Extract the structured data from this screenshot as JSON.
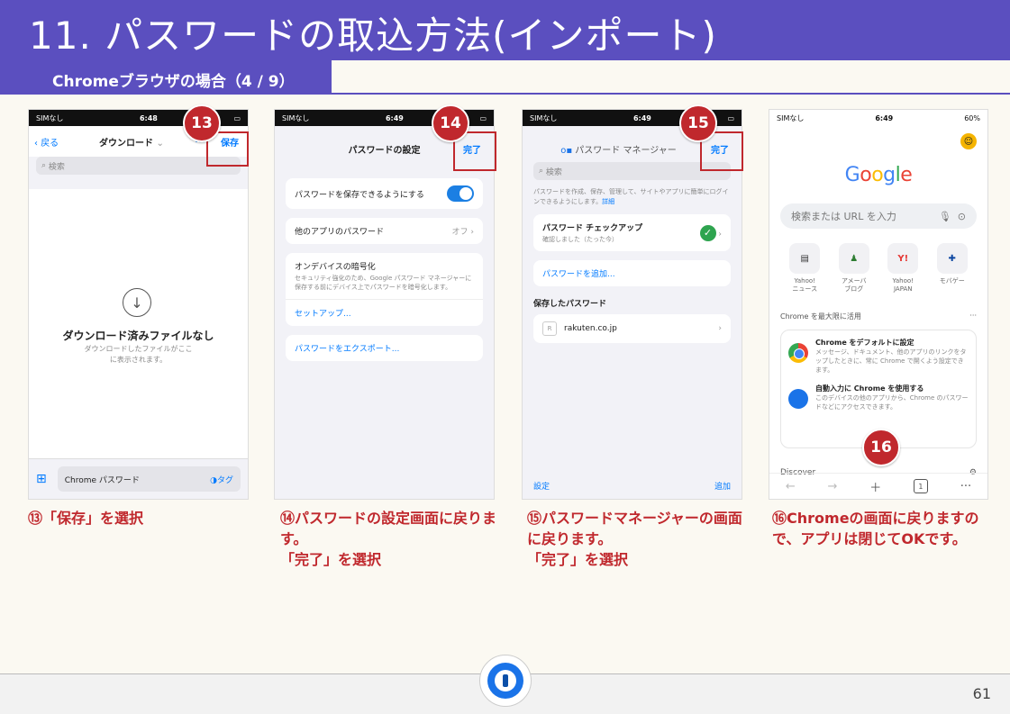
{
  "title": "11. パスワードの取込方法(インポート)",
  "subtitle": "Chromeブラウザの場合（4 / 9）",
  "page_number": "61",
  "brand_color": "#5b4fbf",
  "accent_color": "#c0282d",
  "phone1": {
    "status": {
      "carrier": "SIMなし",
      "time": "6:48"
    },
    "back_label": "戻る",
    "title": "ダウンロード",
    "save_label": "保存",
    "search_placeholder": "検索",
    "empty_title": "ダウンロード済みファイルなし",
    "empty_sub": "ダウンロードしたファイルがここに表示されます。",
    "bottom_file": "Chrome パスワード",
    "bottom_tag": "タグ"
  },
  "phone2": {
    "status": {
      "carrier": "SIMなし",
      "time": "6:49"
    },
    "title": "パスワードの設定",
    "done_label": "完了",
    "autofill_label": "パスワードを保存できるようにする",
    "other_apps_label": "他のアプリのパスワード",
    "other_apps_value": "オフ",
    "encrypt_title": "オンデバイスの暗号化",
    "encrypt_desc": "セキュリティ強化のため、Google パスワード マネージャーに保存する前にデバイス上でパスワードを暗号化します。",
    "setup_link": "セットアップ...",
    "export_link": "パスワードをエクスポート..."
  },
  "phone3": {
    "status": {
      "carrier": "SIMなし",
      "time": "6:49"
    },
    "title": "パスワード マネージャー",
    "done_label": "完了",
    "search_placeholder": "検索",
    "description": "パスワードを作成、保存、管理して、サイトやアプリに簡単にログインできるようにします。",
    "description_link": "詳細",
    "checkup_title": "パスワード チェックアップ",
    "checkup_sub": "確認しました（たった今）",
    "add_password": "パスワードを追加...",
    "saved_header": "保存したパスワード",
    "saved_site": "rakuten.co.jp",
    "settings_label": "設定",
    "add_label": "追加"
  },
  "phone4": {
    "status": {
      "carrier": "SIMなし",
      "time": "6:49",
      "battery": "60%"
    },
    "google_logo": "Google",
    "search_placeholder": "検索または URL を入力",
    "shortcuts": [
      {
        "label": "Yahoo!\nニュース"
      },
      {
        "label": "アメーバ\nブログ"
      },
      {
        "label": "Yahoo!\nJAPAN"
      },
      {
        "label": "モバゲー"
      }
    ],
    "section_title": "Chrome を最大限に活用",
    "card_items": [
      {
        "title": "Chrome をデフォルトに設定",
        "desc": "メッセージ、ドキュメント、他のアプリのリンクをタップしたときに、常に Chrome で開くよう設定できます。"
      },
      {
        "title": "自動入力に Chrome を使用する",
        "desc": "このデバイスの他のアプリから、Chrome のパスワードなどにアクセスできます。"
      }
    ],
    "discover_label": "Discover",
    "tab_count": "1"
  },
  "steps": [
    {
      "badge": "13",
      "caption": "⑬「保存」を選択"
    },
    {
      "badge": "14",
      "caption": "⑭パスワードの設定画面に戻ります。\n「完了」を選択"
    },
    {
      "badge": "15",
      "caption": "⑮パスワードマネージャーの画面に戻ります。\n「完了」を選択"
    },
    {
      "badge": "16",
      "caption": "⑯Chromeの画面に戻りますので、アプリは閉じてOKです。"
    }
  ]
}
